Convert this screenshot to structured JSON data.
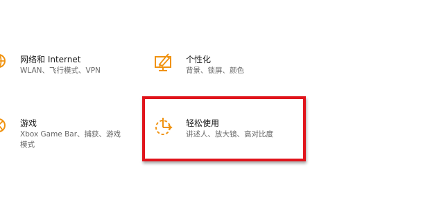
{
  "settings": {
    "tiles": [
      {
        "title": "网络和 Internet",
        "description": "WLAN、飞行模式、VPN",
        "icon": "globe-icon"
      },
      {
        "title": "个性化",
        "description": "背景、锁屏、颜色",
        "icon": "personalization-icon"
      },
      {
        "title": "游戏",
        "description_line1": "Xbox Game Bar、捕获、游戏",
        "description_line2": "模式",
        "icon": "xbox-icon"
      },
      {
        "title": "轻松使用",
        "description": "讲述人、放大镜、高对比度",
        "icon": "ease-of-access-icon"
      }
    ],
    "accent_color": "#f0920f",
    "highlight_color": "#e0141b"
  }
}
